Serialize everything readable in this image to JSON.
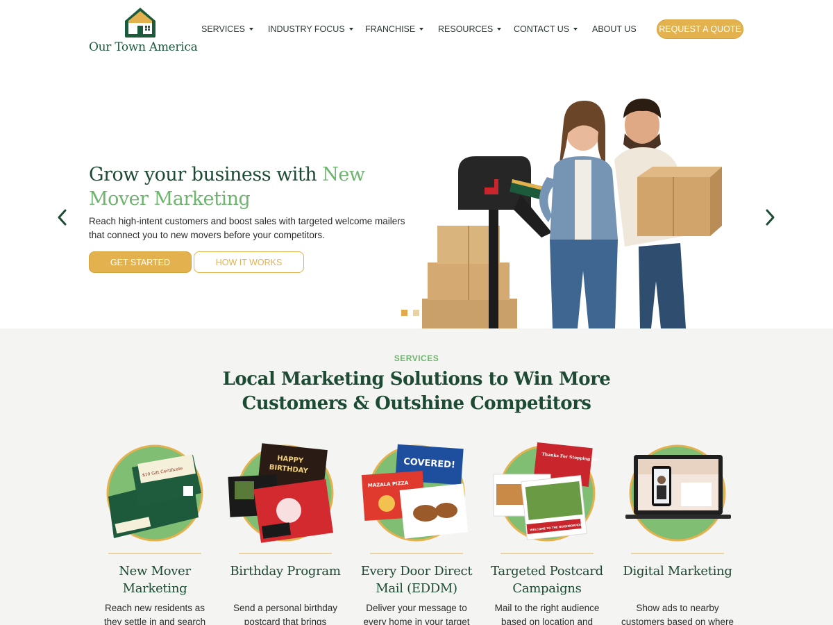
{
  "brand": {
    "name": "Our Town America"
  },
  "nav": {
    "items": [
      {
        "label": "SERVICES",
        "has_dropdown": true
      },
      {
        "label": "INDUSTRY FOCUS",
        "has_dropdown": true
      },
      {
        "label": "FRANCHISE",
        "has_dropdown": true
      },
      {
        "label": "RESOURCES",
        "has_dropdown": true
      },
      {
        "label": "CONTACT US",
        "has_dropdown": true
      },
      {
        "label": "ABOUT US",
        "has_dropdown": false
      }
    ],
    "cta_label": "REQUEST A QUOTE"
  },
  "hero": {
    "title_prefix": "Grow your business with ",
    "title_accent": "New Mover Marketing",
    "subtitle": "Reach high-intent customers and boost sales with targeted welcome mailers that connect you to new movers before your competitors.",
    "primary_button": "GET STARTED",
    "secondary_button": "HOW IT WORKS",
    "slide_count": 3,
    "active_slide": 1
  },
  "services": {
    "eyebrow": "SERVICES",
    "heading": "Local Marketing Solutions to Win More Customers & Outshine Competitors",
    "cards": [
      {
        "title": "New Mover Marketing",
        "desc": "Reach new residents as they settle in and search"
      },
      {
        "title": "Birthday Program",
        "desc": "Send a personal birthday postcard that brings"
      },
      {
        "title": "Every Door Direct Mail (EDDM)",
        "desc": "Deliver your message to every home in your target"
      },
      {
        "title": "Targeted Postcard Campaigns",
        "desc": "Mail to the right audience based on location and"
      },
      {
        "title": "Digital Marketing",
        "desc": "Show ads to nearby customers based on where"
      }
    ]
  },
  "card_art_text": {
    "gift": "$10 Gift Certificate",
    "happy": "HAPPY",
    "birthday": "BIRTHDAY",
    "covered": "COVERED!",
    "pizza": "MAZALA PIZZA",
    "thanks": "Thanks For Stopping In!",
    "welcome": "WELCOME TO THE NEIGHBORHOOD!"
  },
  "colors": {
    "green_dark": "#1d4a33",
    "green_accent": "#6db56c",
    "gold": "#e3b24e",
    "services_bg": "#f4f4f2"
  }
}
